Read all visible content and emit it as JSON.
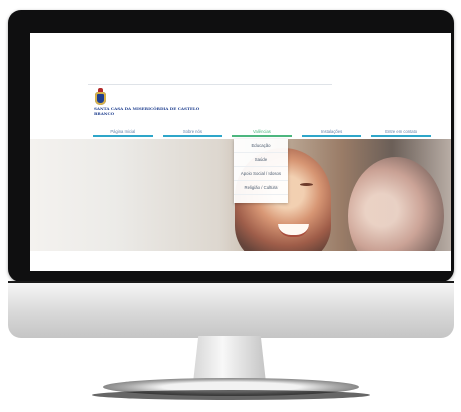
{
  "branding": {
    "organization": "SANTA CASA DA MISERICÓRDIA DE CASTELO BRANCO"
  },
  "navigation": {
    "items": [
      {
        "label": "Página Inicial",
        "active": false
      },
      {
        "label": "Sobre nós",
        "active": false
      },
      {
        "label": "Valências",
        "active": true
      },
      {
        "label": "Instalações",
        "active": false
      },
      {
        "label": "Entre em contato",
        "active": false
      }
    ]
  },
  "submenu": {
    "items": [
      "Educação",
      "Saúde",
      "Apoio Social / Idosos",
      "Religião / Cultura"
    ]
  },
  "hero": {
    "next_arrow": "›"
  },
  "colors": {
    "brand_blue": "#1f3f8f",
    "nav_accent": "#2ea6c9",
    "active_accent": "#4cb67f"
  }
}
